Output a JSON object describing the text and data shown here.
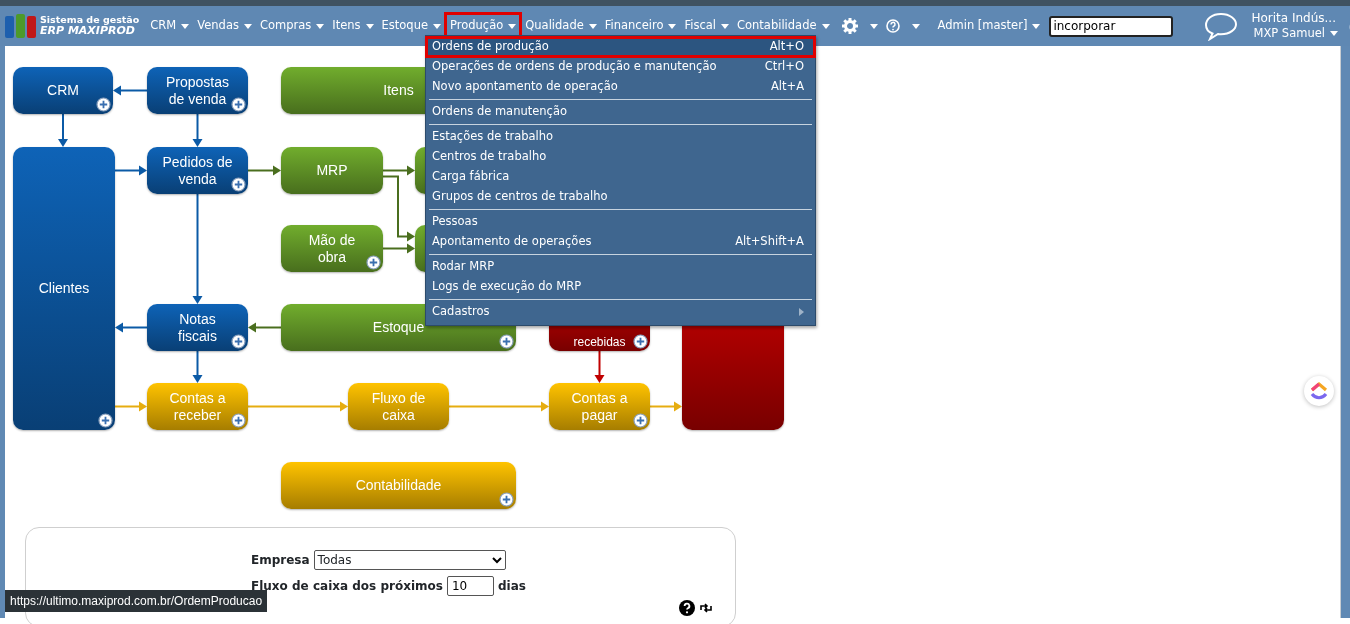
{
  "brand": {
    "line1": "Sistema de gestão",
    "line2": "ERP MAXIPROD"
  },
  "nav": [
    {
      "label": "CRM",
      "selected": false
    },
    {
      "label": "Vendas",
      "selected": false
    },
    {
      "label": "Compras",
      "selected": false
    },
    {
      "label": "Itens",
      "selected": false
    },
    {
      "label": "Estoque",
      "selected": false
    },
    {
      "label": "Produção",
      "selected": true
    },
    {
      "label": "Qualidade",
      "selected": false
    },
    {
      "label": "Financeiro",
      "selected": false
    },
    {
      "label": "Fiscal",
      "selected": false
    },
    {
      "label": "Contabilidade",
      "selected": false
    }
  ],
  "admin": "Admin [master]",
  "search": {
    "value": "incorporar"
  },
  "user": {
    "company": "Horita Indús...",
    "name": "MXP Samuel"
  },
  "menu": [
    [
      {
        "label": "Ordens de produção",
        "shortcut": "Alt+O",
        "selected": true,
        "submenu": false
      },
      {
        "label": "Operações de ordens de produção e manutenção",
        "shortcut": "Ctrl+O",
        "selected": false,
        "submenu": false
      },
      {
        "label": "Novo apontamento de operação",
        "shortcut": "Alt+A",
        "selected": false,
        "submenu": false
      }
    ],
    [
      {
        "label": "Ordens de manutenção",
        "selected": false,
        "submenu": false
      }
    ],
    [
      {
        "label": "Estações de trabalho",
        "selected": false,
        "submenu": false
      },
      {
        "label": "Centros de trabalho",
        "selected": false,
        "submenu": false
      },
      {
        "label": "Carga fábrica",
        "selected": false,
        "submenu": false
      },
      {
        "label": "Grupos de centros de trabalho",
        "selected": false,
        "submenu": false
      }
    ],
    [
      {
        "label": "Pessoas",
        "selected": false,
        "submenu": false
      },
      {
        "label": "Apontamento de operações",
        "shortcut": "Alt+Shift+A",
        "selected": false,
        "submenu": false
      }
    ],
    [
      {
        "label": "Rodar MRP",
        "selected": false,
        "submenu": false
      },
      {
        "label": "Logs de execução do MRP",
        "selected": false,
        "submenu": false
      }
    ],
    [
      {
        "label": "Cadastros",
        "selected": false,
        "submenu": true
      }
    ]
  ],
  "diagram": {
    "nodes": [
      {
        "label": "CRM",
        "color": "#0b4f92",
        "add": true
      },
      {
        "label": "Propostas de venda",
        "color": "#0b4f92",
        "add": true
      },
      {
        "label": "Itens",
        "color": "#5a8a24"
      },
      {
        "label": "Clientes",
        "color": "#0b4f92",
        "add": true
      },
      {
        "label": "Pedidos de venda",
        "color": "#0b4f92",
        "add": true
      },
      {
        "label": "MRP",
        "color": "#5a8a24",
        "add": false
      },
      {
        "color": "#5a8a24"
      },
      {
        "label": "Mão de obra",
        "color": "#5a8a24",
        "add": true
      },
      {
        "color": "#5a8a24"
      },
      {
        "label": "Notas fiscais",
        "color": "#0b4f92",
        "add": true
      },
      {
        "label": "Estoque",
        "color": "#5a8a24",
        "add": true
      },
      {
        "label": "recebidas",
        "color": "#960000",
        "add": true
      },
      {
        "color": "#960000",
        "add": false
      },
      {
        "label": "Contas a receber",
        "color": "#d09c00",
        "add": true
      },
      {
        "label": "Fluxo de caixa",
        "color": "#d09c00",
        "add": false
      },
      {
        "label": "Contas a pagar",
        "color": "#d09c00",
        "add": true
      },
      {
        "label": "Contabilidade",
        "color": "#d09c00",
        "add": true
      }
    ]
  },
  "filters": {
    "company_label": "Empresa",
    "company_value": "Todas",
    "flow_label": "Fluxo de caixa dos próximos",
    "flow_value": "10",
    "flow_unit": "dias"
  },
  "status_url": "https://ultimo.maxiprod.com.br/OrdemProducao"
}
